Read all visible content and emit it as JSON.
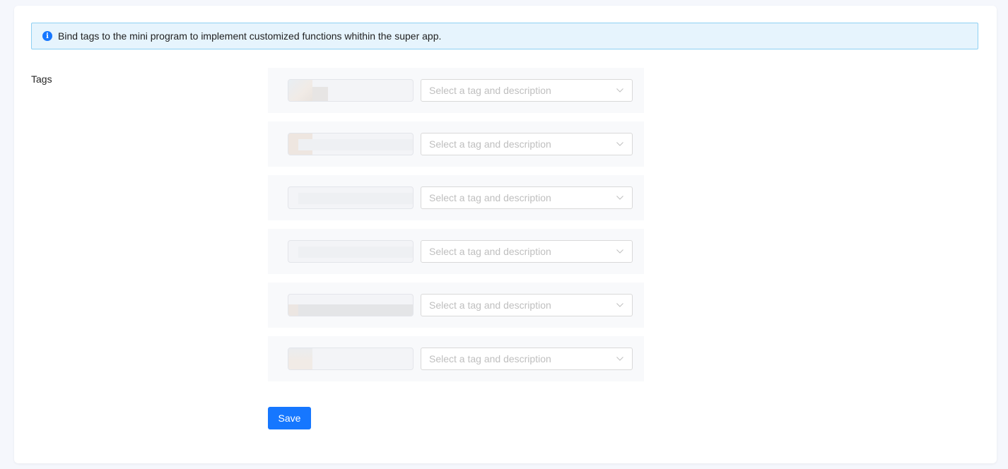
{
  "alert": {
    "icon": "info-icon",
    "icon_glyph": "i",
    "text": "Bind tags to the mini program to implement customized functions whithin the super app."
  },
  "form": {
    "tags_label": "Tags",
    "rows": [
      {
        "select_placeholder": "Select a tag and description"
      },
      {
        "select_placeholder": "Select a tag and description"
      },
      {
        "select_placeholder": "Select a tag and description"
      },
      {
        "select_placeholder": "Select a tag and description"
      },
      {
        "select_placeholder": "Select a tag and description"
      },
      {
        "select_placeholder": "Select a tag and description"
      }
    ],
    "save_label": "Save"
  },
  "colors": {
    "primary": "#1677ff",
    "alert_bg": "#e6f4fd",
    "alert_border": "#8ed0f3",
    "placeholder": "#bfbfbf"
  }
}
